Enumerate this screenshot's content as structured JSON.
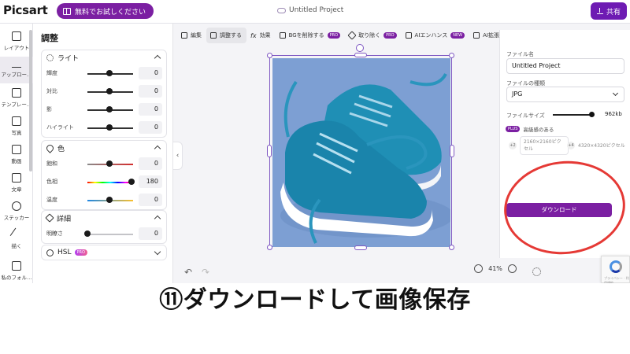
{
  "header": {
    "logo": "Picsart",
    "trial_button": "無料でお試しください",
    "project_title": "Untitled Project",
    "export_button": "共有"
  },
  "rail": {
    "items": [
      {
        "label": "レイアウト",
        "icon": "layout-icon"
      },
      {
        "label": "アップロー…",
        "icon": "upload-icon"
      },
      {
        "label": "テンプレー…",
        "icon": "template-icon"
      },
      {
        "label": "写真",
        "icon": "photo-icon"
      },
      {
        "label": "動画",
        "icon": "video-icon"
      },
      {
        "label": "文章",
        "icon": "text-icon"
      },
      {
        "label": "ステッカー",
        "icon": "sticker-icon"
      },
      {
        "label": "描く",
        "icon": "brush-icon"
      },
      {
        "label": "私のフォル…",
        "icon": "folder-icon"
      }
    ]
  },
  "adjust_panel": {
    "title": "調整",
    "light": {
      "title": "ライト",
      "rows": [
        {
          "label": "輝度",
          "value": "0"
        },
        {
          "label": "対比",
          "value": "0"
        },
        {
          "label": "影",
          "value": "0"
        },
        {
          "label": "ハイライト",
          "value": "0"
        }
      ]
    },
    "color": {
      "title": "色",
      "rows": [
        {
          "label": "飽和",
          "value": "0"
        },
        {
          "label": "色相",
          "value": "180"
        },
        {
          "label": "温度",
          "value": "0"
        }
      ]
    },
    "details": {
      "title": "詳細",
      "rows": [
        {
          "label": "明瞭さ",
          "value": "0"
        }
      ]
    },
    "hsl": {
      "title": "HSL",
      "badge": "PRO"
    }
  },
  "toolbar": {
    "tools": [
      {
        "label": "編集",
        "icon": "edit-icon"
      },
      {
        "label": "調整する",
        "icon": "adjust-icon",
        "active": true
      },
      {
        "label": "効果",
        "icon": "fx-icon"
      },
      {
        "label": "BGを削除する",
        "icon": "remove-bg-icon",
        "badge": "PRO"
      },
      {
        "label": "取り除く",
        "icon": "eraser-icon",
        "badge": "PRO"
      },
      {
        "label": "AIエンハンス",
        "icon": "enhance-icon",
        "badge": "NEW"
      },
      {
        "label": "AI拡張",
        "icon": "ai-expand-icon"
      }
    ]
  },
  "canvas": {
    "zoom": "41%"
  },
  "export_panel": {
    "file_name_label": "ファイル名",
    "file_name_value": "Untitled Project",
    "file_type_label": "ファイルの種類",
    "file_type_value": "JPG",
    "file_size_label": "ファイルサイズ",
    "file_size_value": "962kb",
    "high_quality_badge": "PLUS",
    "high_quality_label": "高級感のある",
    "res_option_1_tag": "+2",
    "res_option_1": "2160×2160ピクセル",
    "res_option_2_tag": "+4",
    "res_option_2": "4320×4320ピクセル",
    "download_button": "ダウンロード"
  },
  "caption": "⑪ダウンロードして画像保存",
  "colors": {
    "brand_purple": "#7b1fa2",
    "annotation_red": "#e53935",
    "shoe_teal": "#1f8fb5",
    "photo_background": "#7d9fd3"
  }
}
